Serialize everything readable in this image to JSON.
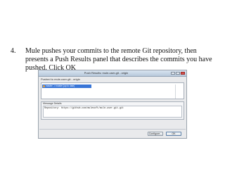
{
  "instruction": {
    "number": "4.",
    "text": "Mule pushes your commits to the remote Git repository, then presents a Push Results panel that describes the commits you have pushed. Click OK"
  },
  "dialog": {
    "title": "Push Results: mule-user-git - origin",
    "header_label": "Pushed to mule-user-git - origin",
    "commit_entry": "master -> master [up to date]",
    "message_section_label": "Message Details",
    "message_text": "Repository: https://github.com/mulesoft/mule-user-git.git",
    "buttons": {
      "configure": "Configure...",
      "ok": "OK"
    }
  }
}
